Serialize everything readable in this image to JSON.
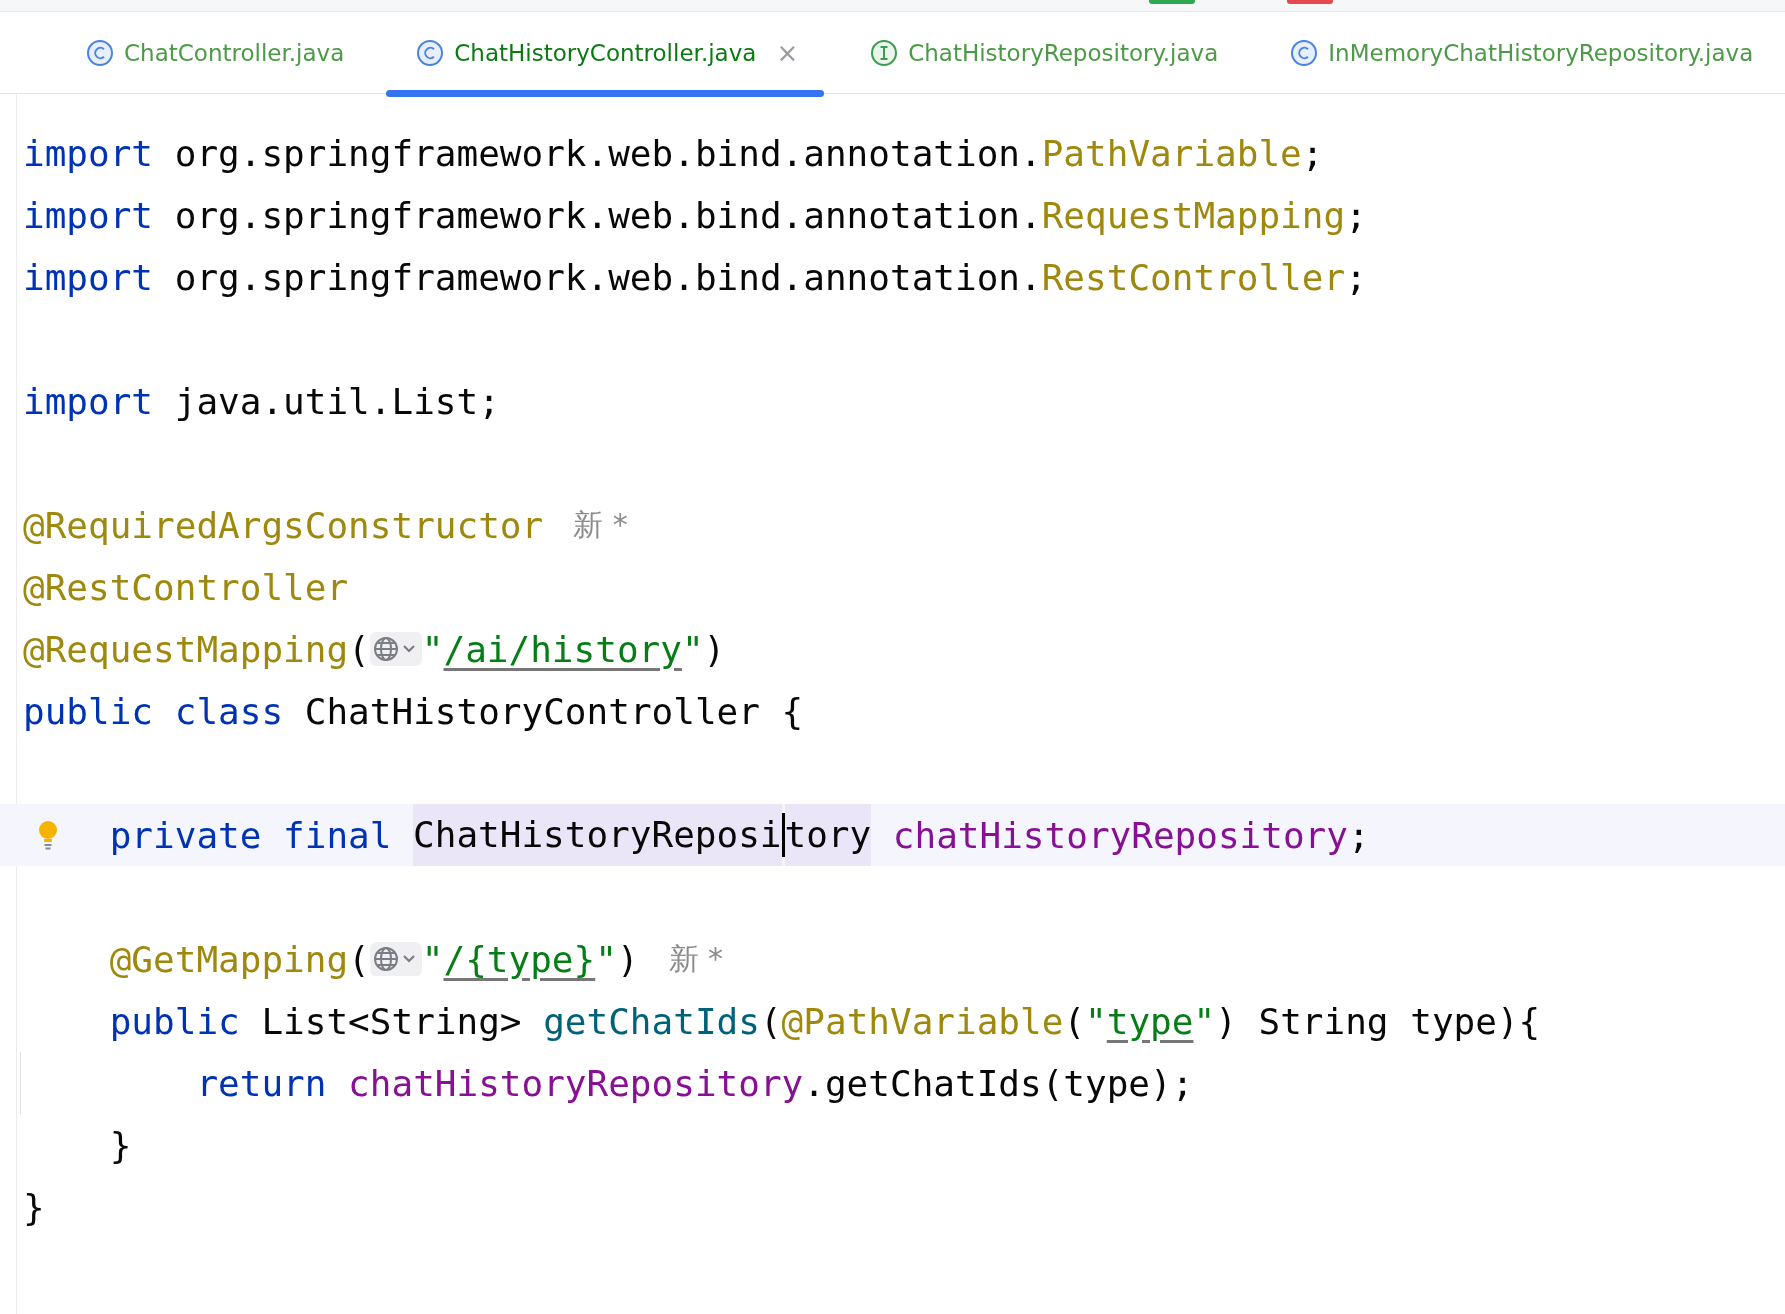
{
  "top_markers": [
    {
      "color": "#2fa84f"
    },
    {
      "color": "#e5484d"
    }
  ],
  "tabs": [
    {
      "label": "ChatController.java",
      "kind": "class",
      "selected": false
    },
    {
      "label": "ChatHistoryController.java",
      "kind": "class",
      "selected": true,
      "close": "×"
    },
    {
      "label": "ChatHistoryRepository.java",
      "kind": "interface",
      "selected": false
    },
    {
      "label": "InMemoryChatHistoryRepository.java",
      "kind": "class",
      "selected": false
    }
  ],
  "code_lines": [
    {
      "kind": "code",
      "segments": [
        {
          "kind": "code",
          "tokens": [
            {
              "t": "import",
              "kind": "kw"
            },
            {
              "t": " org.springframework.web.bind.annotation.",
              "kind": "plain"
            },
            {
              "t": "PathVariable",
              "kind": "ann"
            },
            {
              "t": ";",
              "kind": "plain"
            }
          ]
        }
      ]
    },
    {
      "kind": "code",
      "segments": [
        {
          "kind": "code",
          "tokens": [
            {
              "t": "import",
              "kind": "kw"
            },
            {
              "t": " org.springframework.web.bind.annotation.",
              "kind": "plain"
            },
            {
              "t": "RequestMapping",
              "kind": "ann"
            },
            {
              "t": ";",
              "kind": "plain"
            }
          ]
        }
      ]
    },
    {
      "kind": "code",
      "segments": [
        {
          "kind": "code",
          "tokens": [
            {
              "t": "import",
              "kind": "kw"
            },
            {
              "t": " org.springframework.web.bind.annotation.",
              "kind": "plain"
            },
            {
              "t": "RestController",
              "kind": "ann"
            },
            {
              "t": ";",
              "kind": "plain"
            }
          ]
        }
      ]
    },
    {
      "kind": "blank"
    },
    {
      "kind": "code",
      "segments": [
        {
          "kind": "code",
          "tokens": [
            {
              "t": "import",
              "kind": "kw"
            },
            {
              "t": " java.util.List;",
              "kind": "plain"
            }
          ]
        }
      ]
    },
    {
      "kind": "blank"
    },
    {
      "kind": "code",
      "segments": [
        {
          "kind": "code",
          "tokens": [
            {
              "t": "@RequiredArgsConstructor",
              "kind": "ann"
            }
          ]
        },
        {
          "kind": "hint",
          "text": "新 *"
        }
      ]
    },
    {
      "kind": "code",
      "segments": [
        {
          "kind": "code",
          "tokens": [
            {
              "t": "@RestController",
              "kind": "ann"
            }
          ]
        }
      ]
    },
    {
      "kind": "code",
      "segments": [
        {
          "kind": "code",
          "tokens": [
            {
              "t": "@RequestMapping",
              "kind": "ann"
            },
            {
              "t": "(",
              "kind": "plain"
            }
          ]
        },
        {
          "kind": "globe"
        },
        {
          "kind": "code",
          "tokens": [
            {
              "t": "\"",
              "kind": "str"
            },
            {
              "t": "/ai/history",
              "kind": "url"
            },
            {
              "t": "\"",
              "kind": "str"
            },
            {
              "t": ")",
              "kind": "plain"
            }
          ]
        }
      ]
    },
    {
      "kind": "code",
      "segments": [
        {
          "kind": "code",
          "tokens": [
            {
              "t": "public class",
              "kind": "kw"
            },
            {
              "t": " ChatHistoryController {",
              "kind": "plain"
            }
          ]
        }
      ],
      "children": [
        {
          "kind": "blank"
        },
        {
          "kind": "code",
          "current": true,
          "bulb": true,
          "segments": [
            {
              "kind": "code",
              "selected": false,
              "tokens": [
                {
                  "t": "private final",
                  "kind": "kw"
                }
              ]
            },
            {
              "kind": "code",
              "selected": true,
              "tokens": [
                {
                  "t": "ChatHistoryReposi",
                  "kind": "plain"
                }
              ]
            },
            {
              "kind": "cursor"
            },
            {
              "kind": "code",
              "selected": true,
              "tokens": [
                {
                  "t": "tory",
                  "kind": "plain"
                }
              ]
            },
            {
              "kind": "code",
              "selected": false,
              "tokens": [
                {
                  "t": "chatHistoryRepository",
                  "kind": "field"
                },
                {
                  "t": ";",
                  "kind": "plain"
                }
              ]
            }
          ]
        },
        {
          "kind": "blank"
        },
        {
          "kind": "code",
          "segments": [
            {
              "kind": "code",
              "tokens": [
                {
                  "t": "@GetMapping",
                  "kind": "ann"
                },
                {
                  "t": "(",
                  "kind": "plain"
                }
              ]
            },
            {
              "kind": "globe"
            },
            {
              "kind": "code",
              "tokens": [
                {
                  "t": "\"",
                  "kind": "str"
                },
                {
                  "t": "/{type}",
                  "kind": "url"
                },
                {
                  "t": "\"",
                  "kind": "str"
                },
                {
                  "t": ")",
                  "kind": "plain"
                }
              ]
            },
            {
              "kind": "hint",
              "text": "新 *"
            }
          ]
        },
        {
          "kind": "code",
          "segments": [
            {
              "kind": "code",
              "tokens": [
                {
                  "t": "public",
                  "kind": "kw"
                },
                {
                  "t": " List<String> ",
                  "kind": "plain"
                },
                {
                  "t": "getChatIds",
                  "kind": "method"
                },
                {
                  "t": "(",
                  "kind": "plain"
                },
                {
                  "t": "@PathVariable",
                  "kind": "ann"
                },
                {
                  "t": "(",
                  "kind": "plain"
                },
                {
                  "t": "\"",
                  "kind": "str"
                },
                {
                  "t": "type",
                  "kind": "url"
                },
                {
                  "t": "\"",
                  "kind": "str"
                },
                {
                  "t": ") String type){",
                  "kind": "plain"
                }
              ]
            }
          ],
          "children": [
            {
              "kind": "code",
              "segments": [
                {
                  "kind": "code",
                  "tokens": [
                    {
                      "t": "return ",
                      "kind": "kw"
                    },
                    {
                      "t": "chatHistoryRepository",
                      "kind": "field"
                    },
                    {
                      "t": ".getChatIds(type);",
                      "kind": "plain"
                    }
                  ]
                }
              ]
            }
          ]
        },
        {
          "kind": "code",
          "segments": [
            {
              "kind": "code",
              "tokens": [
                {
                  "t": "}",
                  "kind": "plain"
                }
              ]
            }
          ]
        }
      ]
    },
    {
      "kind": "code",
      "segments": [
        {
          "kind": "code",
          "tokens": [
            {
              "t": "}",
              "kind": "plain"
            }
          ]
        }
      ]
    }
  ]
}
